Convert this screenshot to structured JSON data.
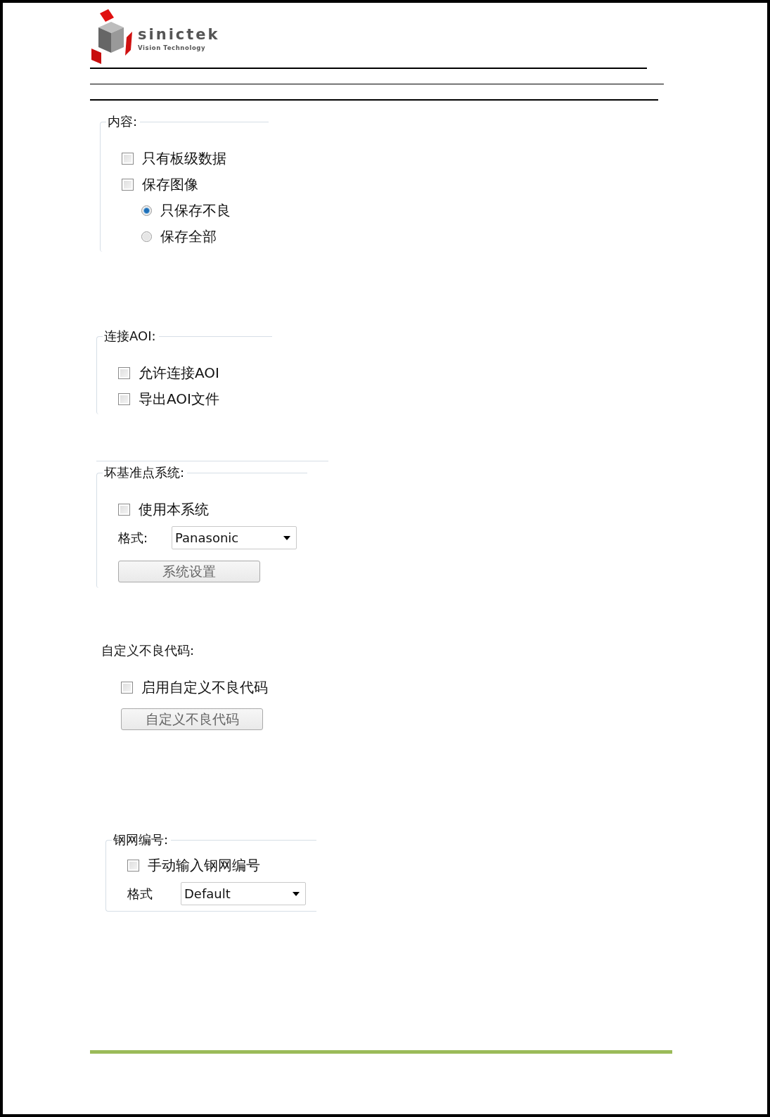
{
  "logo": {
    "name": "sinictek",
    "tagline": "Vision Technology"
  },
  "groups": [
    {
      "title": "内容:",
      "items": [
        {
          "kind": "checkbox",
          "label": "只有板级数据",
          "checked": false
        },
        {
          "kind": "checkbox",
          "label": "保存图像",
          "checked": false
        },
        {
          "kind": "radio",
          "label": "只保存不良",
          "selected": true
        },
        {
          "kind": "radio",
          "label": "保存全部",
          "selected": false
        }
      ]
    },
    {
      "title": "连接AOI:",
      "items": [
        {
          "kind": "checkbox",
          "label": "允许连接AOI",
          "checked": false
        },
        {
          "kind": "checkbox",
          "label": "导出AOI文件",
          "checked": false
        }
      ]
    },
    {
      "title": "坏基准点系统:",
      "items": [
        {
          "kind": "checkbox",
          "label": "使用本系统",
          "checked": false
        },
        {
          "kind": "select",
          "label": "格式:",
          "value": "Panasonic"
        },
        {
          "kind": "button",
          "label": "系统设置"
        }
      ]
    },
    {
      "title": "自定义不良代码:",
      "items": [
        {
          "kind": "checkbox",
          "label": "启用自定义不良代码",
          "checked": false
        },
        {
          "kind": "button",
          "label": "自定义不良代码"
        }
      ]
    },
    {
      "title": "钢网编号:",
      "items": [
        {
          "kind": "checkbox",
          "label": "手动输入钢网编号",
          "checked": false
        },
        {
          "kind": "select",
          "label": "格式",
          "value": "Default"
        }
      ]
    }
  ]
}
